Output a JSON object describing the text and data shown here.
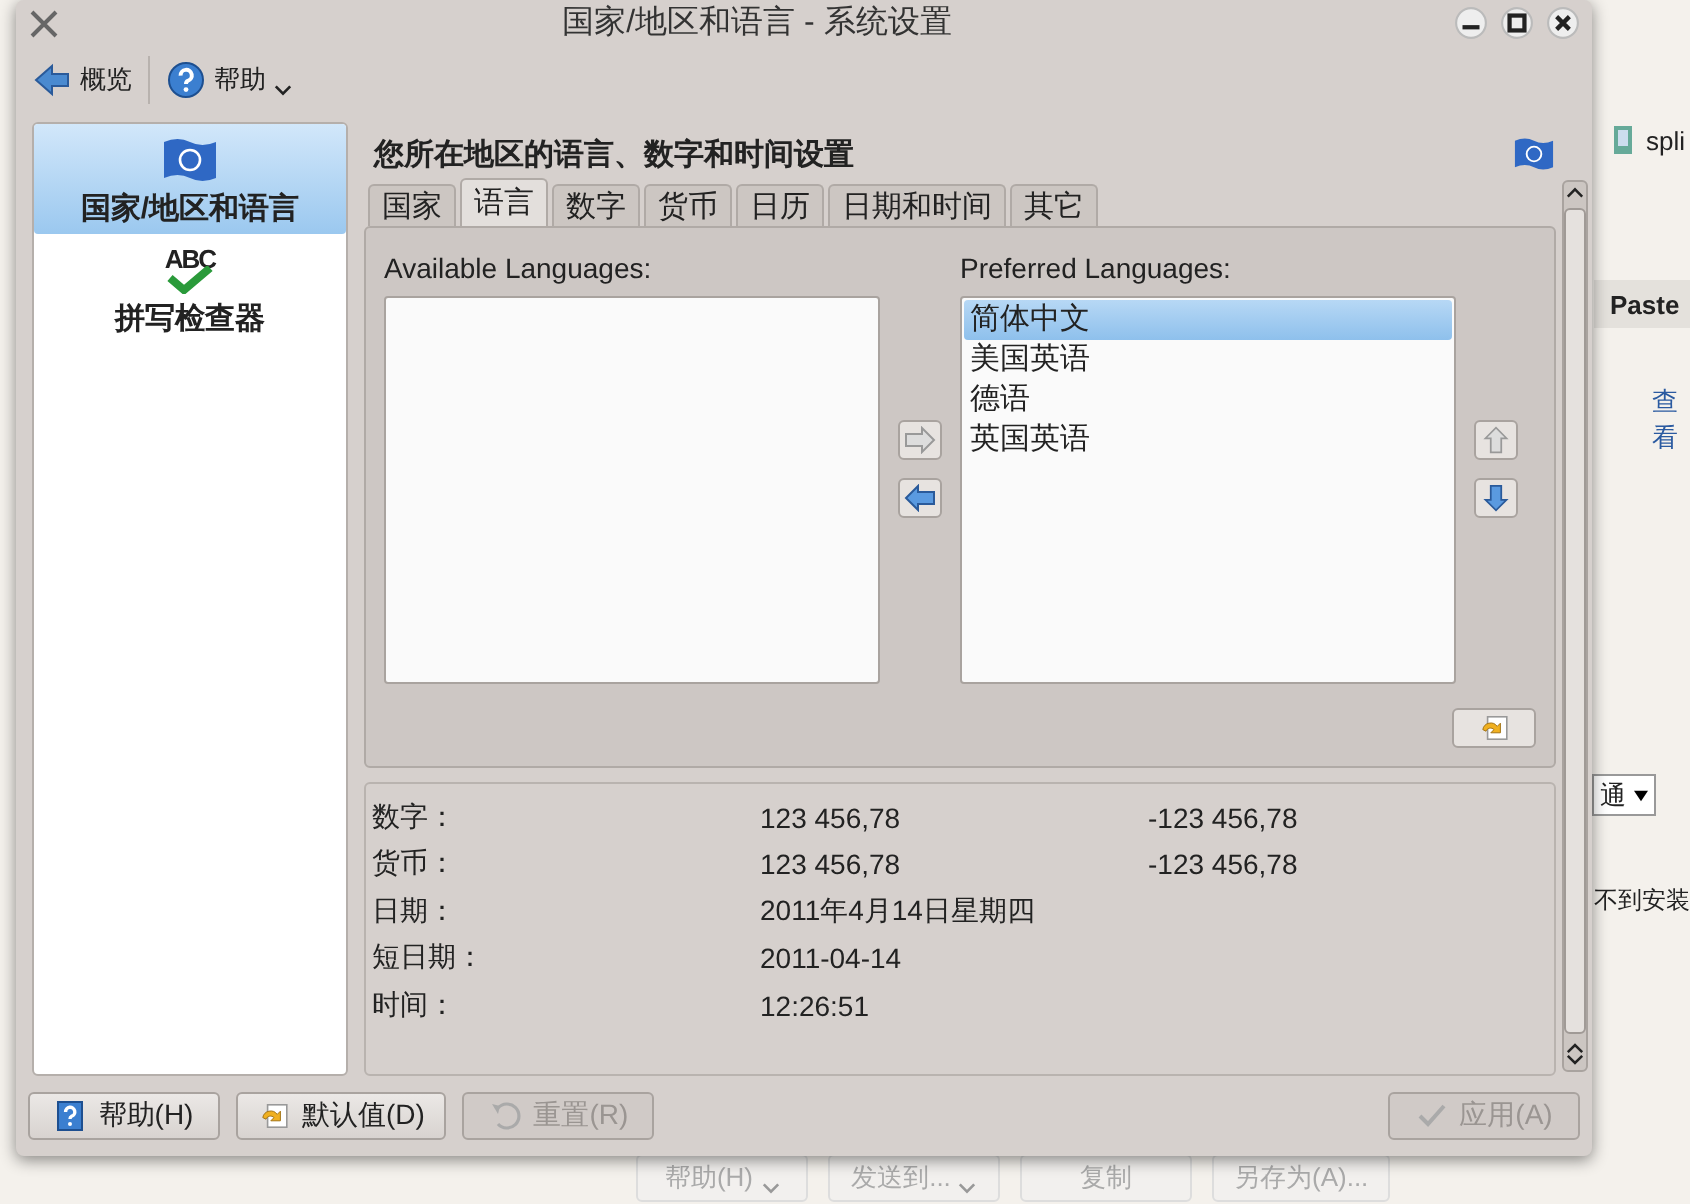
{
  "window": {
    "title": "国家/地区和语言 - 系统设置"
  },
  "toolbar": [
    {
      "label": "概览",
      "kind": "back"
    },
    {
      "label": "帮助",
      "kind": "help-menu"
    }
  ],
  "sidebar": {
    "items": [
      {
        "label": "国家/地区和语言",
        "kind": "flag",
        "selected": true
      },
      {
        "label": "拼写检查器",
        "kind": "spellcheck",
        "icon_text": "ABC",
        "selected": false
      }
    ]
  },
  "page": {
    "heading": "您所在地区的语言、数字和时间设置"
  },
  "tabs": [
    {
      "label": "国家",
      "selected": false
    },
    {
      "label": "语言",
      "selected": true
    },
    {
      "label": "数字",
      "selected": false
    },
    {
      "label": "货币",
      "selected": false
    },
    {
      "label": "日历",
      "selected": false
    },
    {
      "label": "日期和时间",
      "selected": false
    },
    {
      "label": "其它",
      "selected": false
    }
  ],
  "languages": {
    "available_label": "Available Languages:",
    "preferred_label": "Preferred Languages:",
    "preferred": [
      {
        "label": "简体中文",
        "selected": true
      },
      {
        "label": "美国英语",
        "selected": false
      },
      {
        "label": "德语",
        "selected": false
      },
      {
        "label": "英国英语",
        "selected": false
      }
    ]
  },
  "preview": [
    {
      "label": "数字：",
      "value": "123 456,78",
      "negative": "-123 456,78"
    },
    {
      "label": "货币：",
      "value": "123 456,78",
      "negative": "-123 456,78"
    },
    {
      "label": "日期：",
      "value": "2011年4月14日星期四"
    },
    {
      "label": "短日期：",
      "value": "2011-04-14"
    },
    {
      "label": "时间：",
      "value": "12:26:51"
    }
  ],
  "buttons": [
    {
      "label": "帮助(H)",
      "kind": "help",
      "disabled": false
    },
    {
      "label": "默认值(D)",
      "kind": "defaults",
      "disabled": false
    },
    {
      "label": "重置(R)",
      "kind": "reset",
      "disabled": true
    },
    {
      "label": "应用(A)",
      "kind": "apply",
      "disabled": true
    }
  ],
  "snapshot_buttons": [
    {
      "label": "帮助(H)",
      "dropdown": true
    },
    {
      "label": "发送到...",
      "dropdown": true
    },
    {
      "label": "复制",
      "dropdown": false
    },
    {
      "label": "另存为(A)...",
      "dropdown": false
    }
  ],
  "browser": {
    "tab": "spli",
    "column_header": "Paste",
    "link": "查看",
    "select_value": "通",
    "text": "不到安装"
  }
}
